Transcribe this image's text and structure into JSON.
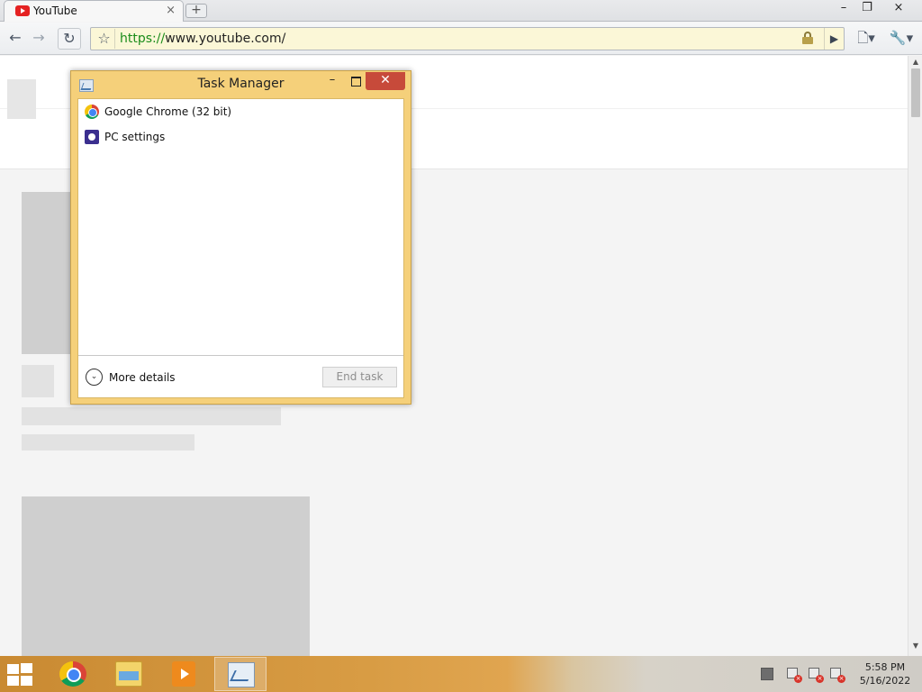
{
  "browser": {
    "tab": {
      "title": "YouTube",
      "close": "×",
      "favicon": "youtube-icon"
    },
    "new_tab": "+",
    "window_controls": {
      "minimize": "–",
      "maximize": "❐",
      "close": "×"
    },
    "toolbar": {
      "back": "←",
      "forward": "→",
      "reload": "↻",
      "star": "☆",
      "url_scheme": "https://",
      "url_rest": "www.youtube.com/",
      "go": "▶",
      "page_menu": "🗋▾",
      "wrench_menu": "🔧▾"
    },
    "colors": {
      "omnibox_bg": "#fbf7d7",
      "url_scheme": "#1a8c1a"
    }
  },
  "scrollbar": {
    "up": "▲",
    "down": "▼"
  },
  "task_manager": {
    "title": "Task Manager",
    "minimize": "–",
    "close": "✕",
    "processes": [
      {
        "name": "Google Chrome (32 bit)",
        "icon": "chrome-icon"
      },
      {
        "name": "PC settings",
        "icon": "gear-icon"
      }
    ],
    "more_details": "More details",
    "more_details_chevron": "⌄",
    "end_task": "End task",
    "colors": {
      "frame": "#f5d07a",
      "close_button": "#c74a3a"
    }
  },
  "taskbar": {
    "items": [
      {
        "name": "Google Chrome",
        "icon": "chrome-icon"
      },
      {
        "name": "File Explorer",
        "icon": "folder-icon"
      },
      {
        "name": "Windows Media Player",
        "icon": "media-player-icon"
      },
      {
        "name": "Task Manager",
        "icon": "task-manager-icon",
        "active": true
      }
    ],
    "clock": {
      "time": "5:58 PM",
      "date": "5/16/2022"
    },
    "tray_x": "×"
  }
}
